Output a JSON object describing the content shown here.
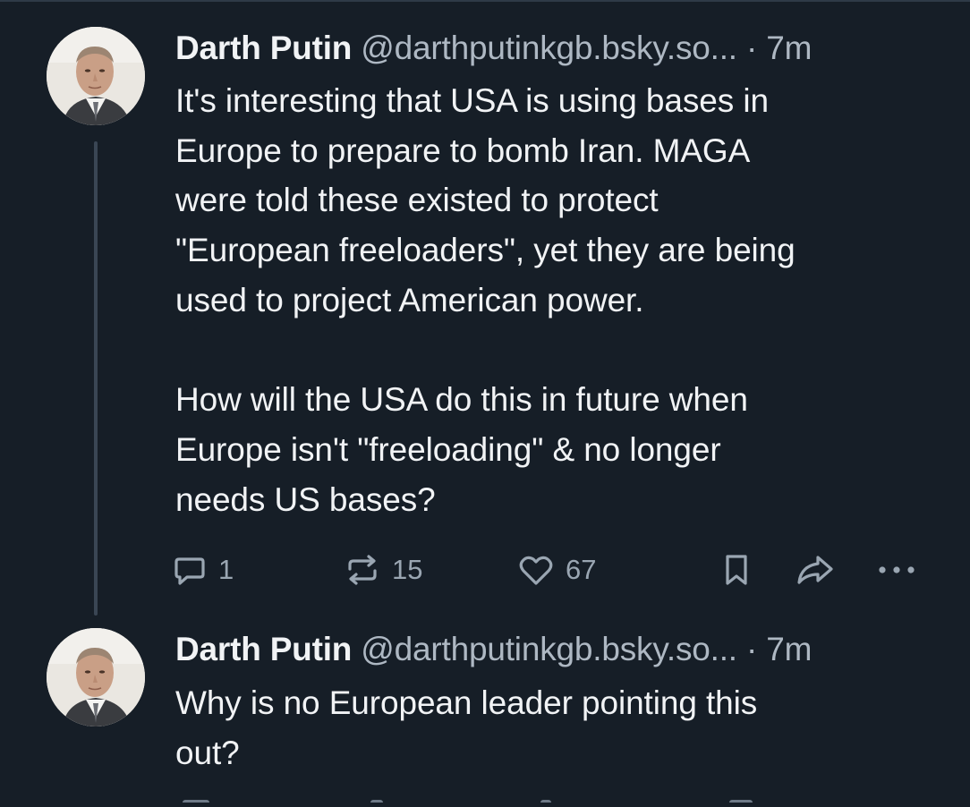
{
  "posts": [
    {
      "author": {
        "display_name": "Darth Putin",
        "handle": "@darthputinkgb.bsky.so...",
        "avatar": "avatar-photo"
      },
      "separator": "·",
      "time": "7m",
      "text": "It's interesting that USA is using bases in\nEurope to prepare to bomb Iran. MAGA\nwere told these existed to protect\n\"European freeloaders\", yet they are being\nused to project American power.\n\nHow will the USA do this in future when\nEurope isn't \"freeloading\" & no longer\nneeds US bases?",
      "actions": {
        "reply_count": "1",
        "repost_count": "15",
        "like_count": "67",
        "icons": [
          "reply-icon",
          "repost-icon",
          "like-icon",
          "bookmark-icon",
          "share-icon",
          "more-icon"
        ]
      }
    },
    {
      "author": {
        "display_name": "Darth Putin",
        "handle": "@darthputinkgb.bsky.so...",
        "avatar": "avatar-photo"
      },
      "separator": "·",
      "time": "7m",
      "text": "Why is no European leader pointing this\nout?"
    }
  ],
  "colors": {
    "background": "#161e27",
    "text_primary": "#f1f3f5",
    "text_secondary": "#aeb8c3",
    "icon": "#9aa6b2",
    "thread_line": "#3a4654"
  }
}
